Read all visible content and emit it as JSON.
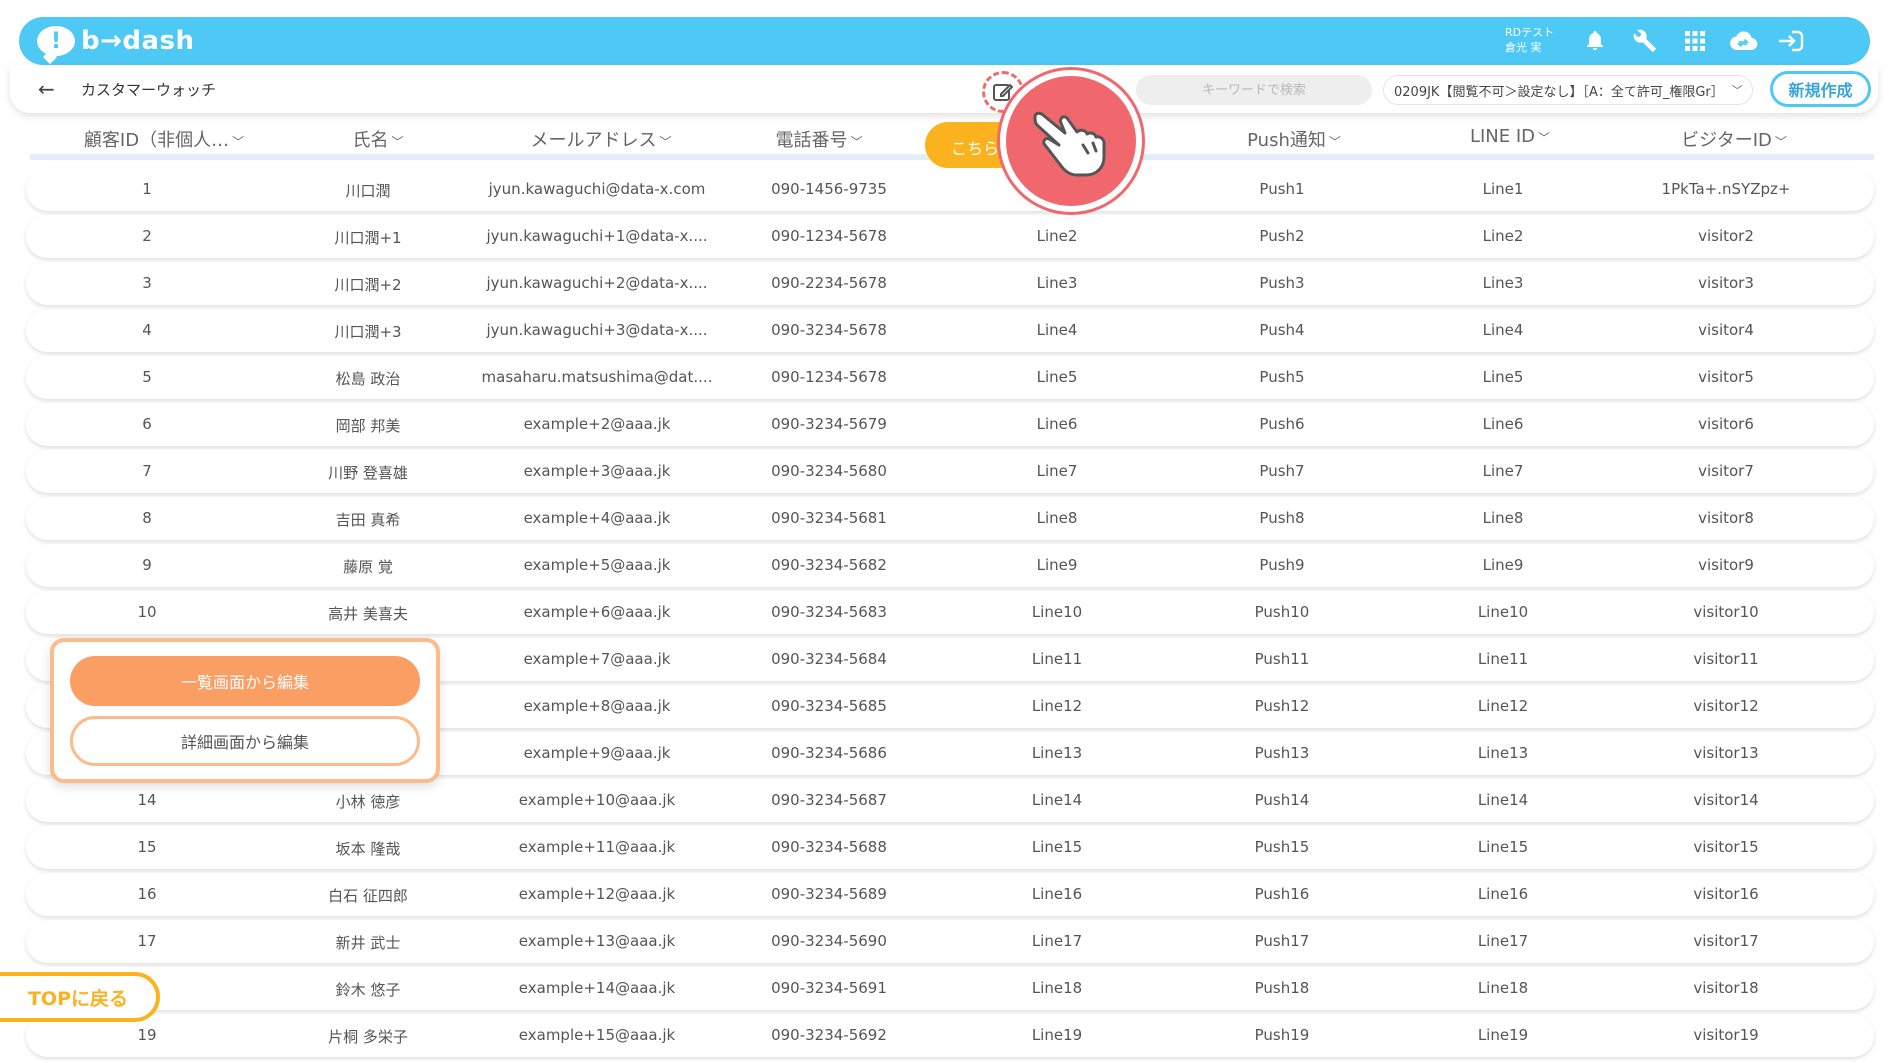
{
  "app": {
    "logo_mark": "!",
    "logo_text": "b→dash",
    "user_line1": "RDテスト",
    "user_line2": "倉光 実"
  },
  "header": {
    "back": "←",
    "title": "カスタマーウォッチ",
    "search_placeholder": "キーワードで検索",
    "segment": "0209JK【閲覧不可＞設定なし】［A：全て許可_権限Gr］",
    "segment_chev": "﹀",
    "new_button": "新規作成"
  },
  "columns": [
    {
      "label": "顧客ID（非個人…"
    },
    {
      "label": "氏名"
    },
    {
      "label": "メールアドレス"
    },
    {
      "label": "電話番号"
    },
    {
      "label": "Push通知"
    },
    {
      "label": "LINE ID"
    },
    {
      "label": "ビジターID"
    }
  ],
  "dropdown_arrow": "﹀",
  "orange_tab_label": "こちら",
  "rows": [
    {
      "id": "1",
      "name": "川口潤",
      "email": "jyun.kawaguchi@data-x.com",
      "phone": "090-1456-9735",
      "line_a": "",
      "push": "Push1",
      "line": "Line1",
      "visitor": "1PkTa+.nSYZpz+"
    },
    {
      "id": "2",
      "name": "川口潤+1",
      "email": "jyun.kawaguchi+1@data-x....",
      "phone": "090-1234-5678",
      "line_a": "Line2",
      "push": "Push2",
      "line": "Line2",
      "visitor": "visitor2"
    },
    {
      "id": "3",
      "name": "川口潤+2",
      "email": "jyun.kawaguchi+2@data-x....",
      "phone": "090-2234-5678",
      "line_a": "Line3",
      "push": "Push3",
      "line": "Line3",
      "visitor": "visitor3"
    },
    {
      "id": "4",
      "name": "川口潤+3",
      "email": "jyun.kawaguchi+3@data-x....",
      "phone": "090-3234-5678",
      "line_a": "Line4",
      "push": "Push4",
      "line": "Line4",
      "visitor": "visitor4"
    },
    {
      "id": "5",
      "name": "松島 政治",
      "email": "masaharu.matsushima@dat....",
      "phone": "090-1234-5678",
      "line_a": "Line5",
      "push": "Push5",
      "line": "Line5",
      "visitor": "visitor5"
    },
    {
      "id": "6",
      "name": "岡部 邦美",
      "email": "example+2@aaa.jk",
      "phone": "090-3234-5679",
      "line_a": "Line6",
      "push": "Push6",
      "line": "Line6",
      "visitor": "visitor6"
    },
    {
      "id": "7",
      "name": "川野 登喜雄",
      "email": "example+3@aaa.jk",
      "phone": "090-3234-5680",
      "line_a": "Line7",
      "push": "Push7",
      "line": "Line7",
      "visitor": "visitor7"
    },
    {
      "id": "8",
      "name": "吉田 真希",
      "email": "example+4@aaa.jk",
      "phone": "090-3234-5681",
      "line_a": "Line8",
      "push": "Push8",
      "line": "Line8",
      "visitor": "visitor8"
    },
    {
      "id": "9",
      "name": "藤原 覚",
      "email": "example+5@aaa.jk",
      "phone": "090-3234-5682",
      "line_a": "Line9",
      "push": "Push9",
      "line": "Line9",
      "visitor": "visitor9"
    },
    {
      "id": "10",
      "name": "高井 美喜夫",
      "email": "example+6@aaa.jk",
      "phone": "090-3234-5683",
      "line_a": "Line10",
      "push": "Push10",
      "line": "Line10",
      "visitor": "visitor10"
    },
    {
      "id": "",
      "name": "",
      "email": "example+7@aaa.jk",
      "phone": "090-3234-5684",
      "line_a": "Line11",
      "push": "Push11",
      "line": "Line11",
      "visitor": "visitor11"
    },
    {
      "id": "",
      "name": "",
      "email": "example+8@aaa.jk",
      "phone": "090-3234-5685",
      "line_a": "Line12",
      "push": "Push12",
      "line": "Line12",
      "visitor": "visitor12"
    },
    {
      "id": "",
      "name": "",
      "email": "example+9@aaa.jk",
      "phone": "090-3234-5686",
      "line_a": "Line13",
      "push": "Push13",
      "line": "Line13",
      "visitor": "visitor13"
    },
    {
      "id": "14",
      "name": "小林 徳彦",
      "email": "example+10@aaa.jk",
      "phone": "090-3234-5687",
      "line_a": "Line14",
      "push": "Push14",
      "line": "Line14",
      "visitor": "visitor14"
    },
    {
      "id": "15",
      "name": "坂本 隆哉",
      "email": "example+11@aaa.jk",
      "phone": "090-3234-5688",
      "line_a": "Line15",
      "push": "Push15",
      "line": "Line15",
      "visitor": "visitor15"
    },
    {
      "id": "16",
      "name": "白石 征四郎",
      "email": "example+12@aaa.jk",
      "phone": "090-3234-5689",
      "line_a": "Line16",
      "push": "Push16",
      "line": "Line16",
      "visitor": "visitor16"
    },
    {
      "id": "17",
      "name": "新井 武士",
      "email": "example+13@aaa.jk",
      "phone": "090-3234-5690",
      "line_a": "Line17",
      "push": "Push17",
      "line": "Line17",
      "visitor": "visitor17"
    },
    {
      "id": "",
      "name": "鈴木 悠子",
      "email": "example+14@aaa.jk",
      "phone": "090-3234-5691",
      "line_a": "Line18",
      "push": "Push18",
      "line": "Line18",
      "visitor": "visitor18"
    },
    {
      "id": "19",
      "name": "片桐 多栄子",
      "email": "example+15@aaa.jk",
      "phone": "090-3234-5692",
      "line_a": "Line19",
      "push": "Push19",
      "line": "Line19",
      "visitor": "visitor19"
    }
  ],
  "popup": {
    "edit_from_list": "一覧画面から編集",
    "edit_from_detail": "詳細画面から編集"
  },
  "top_return": "TOPに戻る",
  "colors": {
    "brand_blue": "#4ec8f4",
    "orange": "#fbb21f",
    "popup_orange": "#fb9e63",
    "pointer_red": "#f0676e"
  },
  "icons": {
    "bell": "bell-icon",
    "wrench": "wrench-icon",
    "apps": "apps-grid-icon",
    "cloud": "cloud-sync-icon",
    "logout": "logout-icon",
    "edit": "edit-icon",
    "hand": "hand-pointer-icon"
  }
}
